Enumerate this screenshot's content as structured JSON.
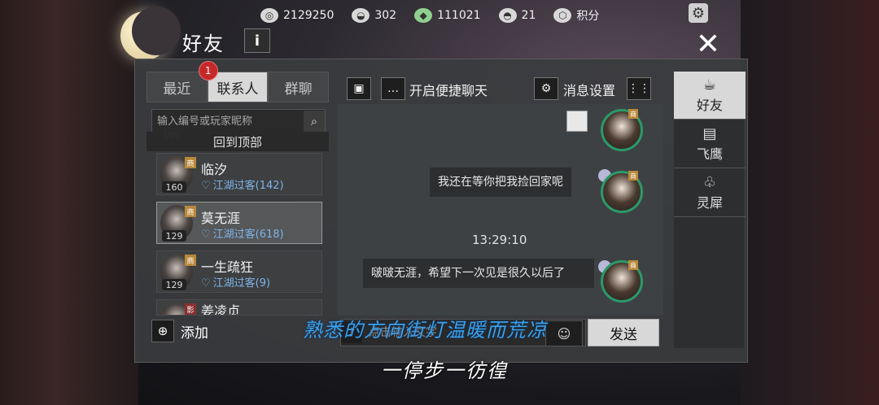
{
  "resources": [
    {
      "icon": "coin-icon",
      "value": "2129250"
    },
    {
      "icon": "ingot-icon",
      "value": "302"
    },
    {
      "icon": "jade-icon",
      "value": "111021"
    },
    {
      "icon": "silver-icon",
      "value": "21"
    },
    {
      "icon": "points-icon",
      "value": "积分"
    }
  ],
  "header": {
    "title": "好友",
    "info_label": "i",
    "close_label": "✕"
  },
  "tabs": {
    "recent": "最近",
    "contacts": "联系人",
    "contacts_badge": "1",
    "groups": "群聊"
  },
  "search": {
    "placeholder": "输入编号或玩家昵称"
  },
  "back_to_top": "回到顶部",
  "ghost_level": "109",
  "contacts": [
    {
      "name": "临汐",
      "level": "160",
      "rank": "江湖过客(142)",
      "tag": "商"
    },
    {
      "name": "莫无涯",
      "level": "129",
      "rank": "江湖过客(618)",
      "tag": "商"
    },
    {
      "name": "一生疏狂",
      "level": "129",
      "rank": "江湖过客(9)",
      "tag": "商"
    },
    {
      "name": "姜凌贞",
      "level": "",
      "rank": "",
      "tag": "影"
    }
  ],
  "add_label": "添加",
  "toolbar": {
    "quick_chat": "开启便捷聊天",
    "msg_settings": "消息设置"
  },
  "chat": {
    "messages": [
      {
        "text": "我还在等你把我捡回家呢"
      },
      {
        "text": "啵啵无涯，希望下一次见是很久以后了"
      }
    ],
    "time": "13:29:10",
    "input_placeholder": "点击输入文字",
    "send_label": "发送"
  },
  "side_tabs": [
    {
      "label": "好友",
      "icon": "tea-icon"
    },
    {
      "label": "飞鹰",
      "icon": "scroll-icon"
    },
    {
      "label": "灵犀",
      "icon": "bell-icon"
    }
  ],
  "subtitles": {
    "line1": "熟悉的方向街灯温暖而荒凉",
    "line2": "一停步一彷徨"
  },
  "colors": {
    "accent_blue": "#7fb4e8",
    "badge_red": "#c62828",
    "subtitle_blue": "#3aa0e8"
  }
}
